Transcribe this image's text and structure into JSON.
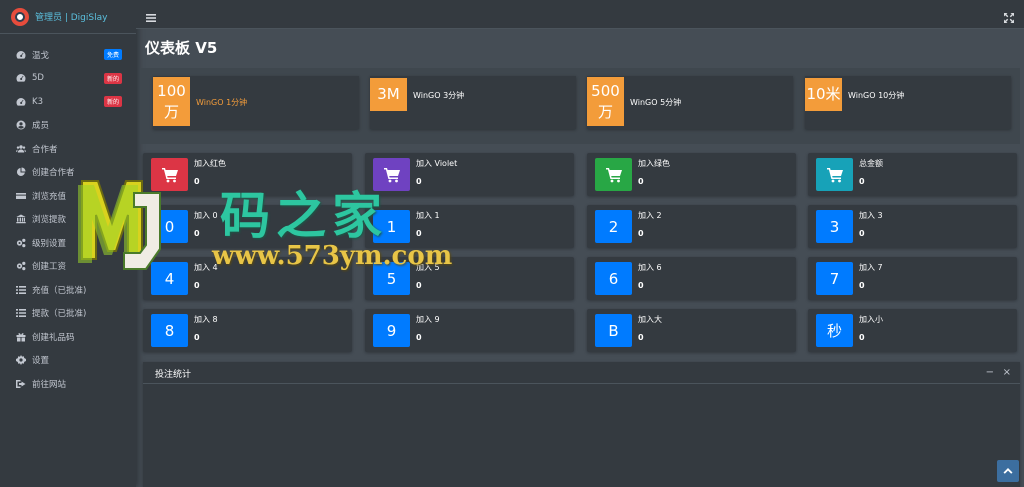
{
  "brand": {
    "title": "管理员 | DigiSlay"
  },
  "sidebar": {
    "items": [
      {
        "label": "温戈",
        "icon": "dashboard-icon",
        "badge": "免费",
        "badge_color": "blue"
      },
      {
        "label": "5D",
        "icon": "dashboard-icon",
        "badge": "新的",
        "badge_color": "red"
      },
      {
        "label": "K3",
        "icon": "dashboard-icon",
        "badge": "新的",
        "badge_color": "red"
      },
      {
        "label": "成员",
        "icon": "user-circle-icon"
      },
      {
        "label": "合作者",
        "icon": "users-icon"
      },
      {
        "label": "创建合作者",
        "icon": "pie-chart-icon"
      },
      {
        "label": "浏览充值",
        "icon": "credit-card-icon"
      },
      {
        "label": "浏览提款",
        "icon": "bank-icon"
      },
      {
        "label": "级别设置",
        "icon": "cogs-icon"
      },
      {
        "label": "创建工资",
        "icon": "cogs-icon"
      },
      {
        "label": "充值（已批准)",
        "icon": "list-icon"
      },
      {
        "label": "提款（已批准)",
        "icon": "list-icon"
      },
      {
        "label": "创建礼品码",
        "icon": "gift-icon"
      },
      {
        "label": "设置",
        "icon": "gear-icon"
      },
      {
        "label": "前往网站",
        "icon": "sign-out-icon"
      }
    ]
  },
  "page": {
    "title": "仪表板 V5"
  },
  "games": [
    {
      "square": "100万",
      "square_top": "100",
      "square_bottom": "万",
      "name": "WinGO 1分钟",
      "name_color": "#f39c3a"
    },
    {
      "square": "3M",
      "square_top": "3M",
      "square_bottom": "",
      "name": "WinGO 3分钟",
      "name_color": "#ffffff"
    },
    {
      "square": "500万",
      "square_top": "500",
      "square_bottom": "万",
      "name": "WinGO 5分钟",
      "name_color": "#ffffff"
    },
    {
      "square": "10米",
      "square_top": "10米",
      "square_bottom": "",
      "name": "WinGO 10分钟",
      "name_color": "#ffffff"
    }
  ],
  "stats": [
    {
      "label": "加入红色",
      "value": "0",
      "icon": "cart-icon",
      "color": "#dc3545"
    },
    {
      "label": "加入 Violet",
      "value": "0",
      "icon": "cart-icon",
      "color": "#6f42c1"
    },
    {
      "label": "加入绿色",
      "value": "0",
      "icon": "cart-icon",
      "color": "#28a745"
    },
    {
      "label": "总金额",
      "value": "0",
      "icon": "cart-icon",
      "color": "#17a2b8"
    },
    {
      "label": "加入 0",
      "value": "0",
      "box": "0",
      "color": "#007bff"
    },
    {
      "label": "加入 1",
      "value": "0",
      "box": "1",
      "color": "#007bff"
    },
    {
      "label": "加入 2",
      "value": "0",
      "box": "2",
      "color": "#007bff"
    },
    {
      "label": "加入 3",
      "value": "0",
      "box": "3",
      "color": "#007bff"
    },
    {
      "label": "加入 4",
      "value": "0",
      "box": "4",
      "color": "#007bff"
    },
    {
      "label": "加入 5",
      "value": "0",
      "box": "5",
      "color": "#007bff"
    },
    {
      "label": "加入 6",
      "value": "0",
      "box": "6",
      "color": "#007bff"
    },
    {
      "label": "加入 7",
      "value": "0",
      "box": "7",
      "color": "#007bff"
    },
    {
      "label": "加入 8",
      "value": "0",
      "box": "8",
      "color": "#007bff"
    },
    {
      "label": "加入 9",
      "value": "0",
      "box": "9",
      "color": "#007bff"
    },
    {
      "label": "加入大",
      "value": "0",
      "box": "B",
      "color": "#007bff"
    },
    {
      "label": "加入小",
      "value": "0",
      "box": "秒",
      "color": "#007bff"
    }
  ],
  "card": {
    "title": "投注统计",
    "collapse": "−",
    "close": "×"
  },
  "watermark": {
    "text": "码之家",
    "url": "www.573ym.com",
    "logo": "MJ"
  }
}
